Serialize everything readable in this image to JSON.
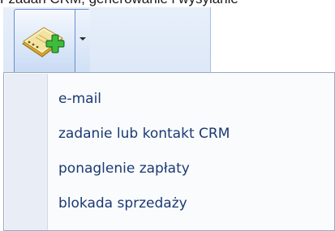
{
  "background_text": "Fzadań CRM, generowanie i wysyłanie",
  "toolbar": {
    "button_icon": "address-book-add-icon",
    "dropdown_icon": "dropdown-arrow-icon"
  },
  "menu": {
    "items": [
      {
        "label": "e-mail"
      },
      {
        "label": "zadanie lub kontakt CRM"
      },
      {
        "label": "ponaglenie zapłaty"
      },
      {
        "label": "blokada sprzedaży"
      }
    ]
  },
  "colors": {
    "menu_text": "#1b3a73",
    "button_border": "#6a8ecc",
    "book_color": "#e8c24a",
    "plus_color": "#2fa52f"
  }
}
